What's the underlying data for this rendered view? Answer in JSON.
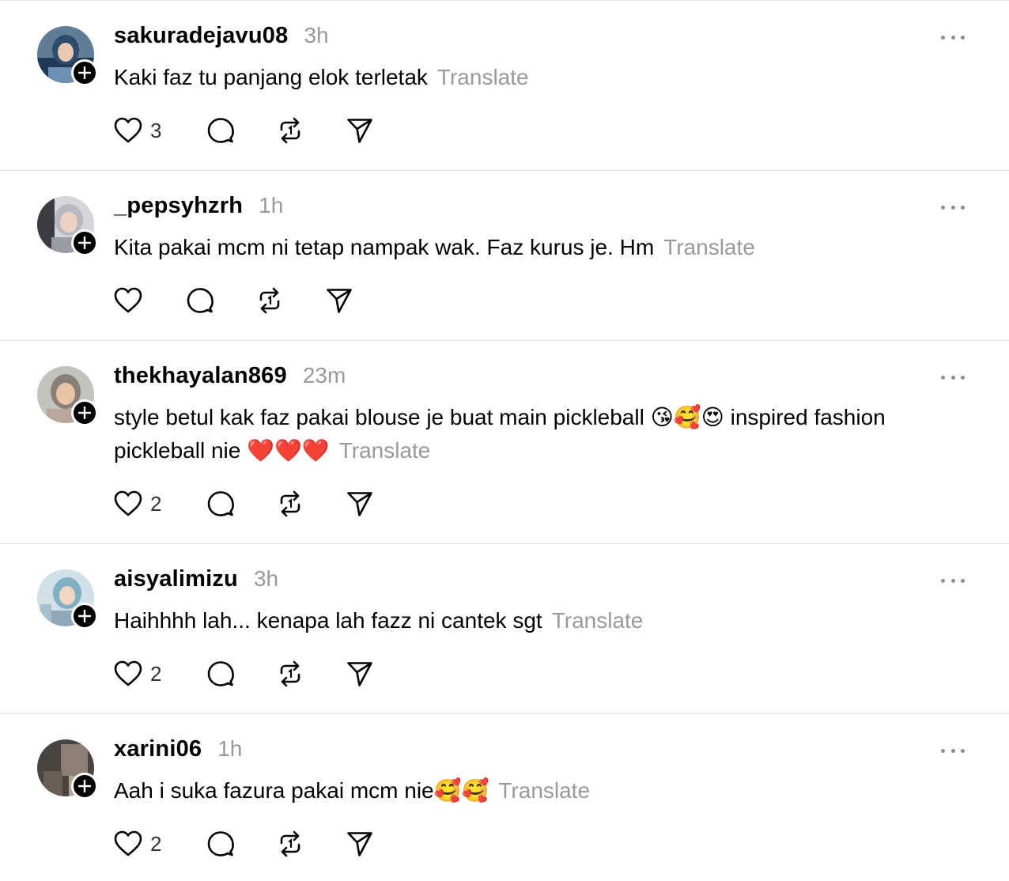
{
  "posts": [
    {
      "username": "sakuradejavu08",
      "time": "3h",
      "text": "Kaki faz tu panjang elok terletak",
      "translate": "Translate",
      "likes": "3"
    },
    {
      "username": "_pepsyhzrh",
      "time": "1h",
      "text": "Kita pakai mcm ni tetap nampak wak. Faz kurus je. Hm",
      "translate": "Translate",
      "likes": ""
    },
    {
      "username": "thekhayalan869",
      "time": "23m",
      "text": "style betul kak faz pakai blouse je buat main pickleball 😘🥰😍 inspired fashion pickleball nie ❤️❤️❤️",
      "translate": "Translate",
      "likes": "2"
    },
    {
      "username": "aisyalimizu",
      "time": "3h",
      "text": "Haihhhh lah... kenapa lah fazz ni cantek sgt",
      "translate": "Translate",
      "likes": "2"
    },
    {
      "username": "xarini06",
      "time": "1h",
      "text": "Aah i suka fazura pakai mcm nie🥰🥰",
      "translate": "Translate",
      "likes": "2"
    }
  ],
  "icons": {
    "like": "heart-icon",
    "reply": "comment-icon",
    "repost": "repost-icon",
    "share": "send-icon",
    "more": "more-icon",
    "follow": "plus-icon"
  },
  "colors": {
    "text": "#000000",
    "muted": "#999999",
    "divider": "#dedede"
  }
}
